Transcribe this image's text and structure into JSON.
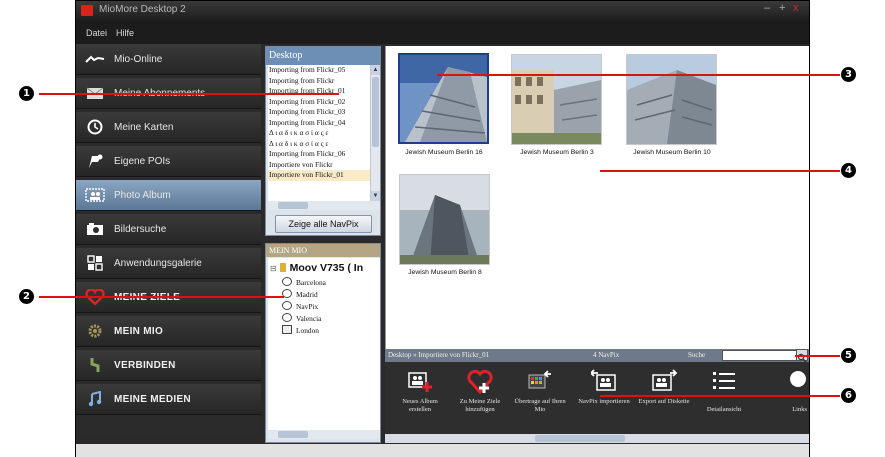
{
  "window": {
    "title": "MioMore Desktop 2",
    "controls": [
      "–",
      "+",
      "x"
    ]
  },
  "menu": [
    "Datei",
    "Hilfe"
  ],
  "sidebar": {
    "items": [
      {
        "label": "Mio-Online",
        "icon": "mio-wave-icon"
      },
      {
        "label": "Meine Abonnements",
        "icon": "envelope-icon"
      },
      {
        "label": "Meine Karten",
        "icon": "compass-icon"
      },
      {
        "label": "Eigene POIs",
        "icon": "poi-flag-icon"
      },
      {
        "label": "Photo Album",
        "icon": "photo-album-icon"
      },
      {
        "label": "Bildersuche",
        "icon": "camera-icon"
      },
      {
        "label": "Anwendungsgalerie",
        "icon": "apps-grid-icon"
      },
      {
        "label": "MEINE ZIELE",
        "icon": "heart-icon"
      },
      {
        "label": "MEIN MIO",
        "icon": "gear-icon"
      },
      {
        "label": "VERBINDEN",
        "icon": "connect-icon"
      },
      {
        "label": "MEINE MEDIEN",
        "icon": "music-note-icon"
      }
    ]
  },
  "desktop_panel": {
    "title": "Desktop",
    "items": [
      "Importing from Flickr_05",
      "Importing from Flickr",
      "Importing from Flickr_01",
      "Importing from Flickr_02",
      "Importing from Flickr_03",
      "Importing from Flickr_04",
      "Δ ι α δ ι κ α σ ί α ς ε",
      "Δ ι α δ ι κ α σ ί α ς ε",
      "Importing from Flickr_06",
      "Importiere von Flickr",
      "Importiere von Flickr_01"
    ],
    "show_all_button": "Zeige alle NavPix"
  },
  "meinmio_panel": {
    "title": "MEIN MIO",
    "device": "Moov V735 ( In",
    "folders": [
      "Barcelona",
      "Madrid",
      "NavPix",
      "Valencia",
      "London"
    ]
  },
  "photos": [
    {
      "caption": "Jewish Museum Berlin 16",
      "selected": true
    },
    {
      "caption": "Jewish Museum Berlin 3",
      "selected": false
    },
    {
      "caption": "Jewish Museum Berlin 10",
      "selected": false
    },
    {
      "caption": "Jewish Museum Berlin 8",
      "selected": false
    }
  ],
  "status": {
    "breadcrumb": "Desktop » Importiere von Flickr_01",
    "count": "4 NavPix",
    "search_label": "Suche"
  },
  "toolbar": {
    "buttons": [
      {
        "label": "Neues Album erstellen",
        "icon": "new-album-icon"
      },
      {
        "label": "Zu Meine Ziele hinzufügen",
        "icon": "add-to-destinations-icon"
      },
      {
        "label": "Übertrage auf Ihren Mio",
        "icon": "transfer-to-mio-icon"
      },
      {
        "label": "NavPix importieren",
        "icon": "import-navpix-icon"
      },
      {
        "label": "Export auf Diskette",
        "icon": "export-disk-icon"
      },
      {
        "label": "Detailansicht",
        "icon": "detail-view-icon"
      },
      {
        "label": "Links",
        "icon": "rotate-left-icon"
      }
    ]
  },
  "callouts": [
    "1",
    "2",
    "3",
    "4",
    "5",
    "6"
  ],
  "colors": {
    "leader_line": "#e01010",
    "active_item": "#7391b0",
    "sidebar_bg": "#2b2b2b"
  }
}
